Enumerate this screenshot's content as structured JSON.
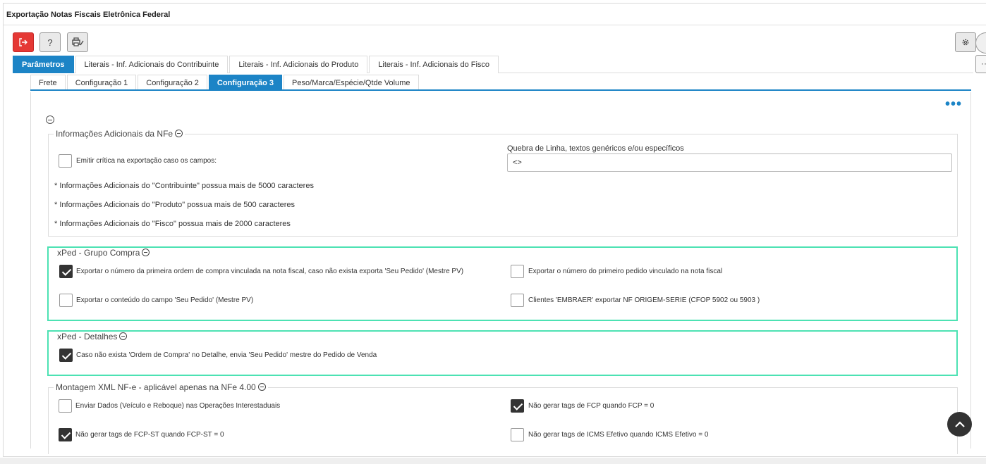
{
  "window": {
    "title": "Exportação Notas Fiscais Eletrônica Federal"
  },
  "toolbar": {
    "exit_icon": "exit-icon",
    "help_label": "?",
    "print_icon": "printer-icon",
    "settings_icon": "gear-icon",
    "side_menu_label": "··"
  },
  "tabs": [
    {
      "label": "Parâmetros",
      "active": true
    },
    {
      "label": "Literais - Inf. Adicionais do Contribuinte",
      "active": false
    },
    {
      "label": "Literais - Inf. Adicionais do Produto",
      "active": false
    },
    {
      "label": "Literais - Inf. Adicionais do Fisco",
      "active": false
    }
  ],
  "subtabs": [
    {
      "label": "Frete",
      "active": false
    },
    {
      "label": "Configuração 1",
      "active": false
    },
    {
      "label": "Configuração 2",
      "active": false
    },
    {
      "label": "Configuração 3",
      "active": true
    },
    {
      "label": "Peso/Marca/Espécie/Qtde Volume",
      "active": false
    }
  ],
  "more_label": "•••",
  "info_group": {
    "legend": "Informações Adicionais da NFe",
    "emitir_label": "Emitir crítica na exportação caso os campos:",
    "emitir_checked": false,
    "quebra_label": "Quebra de Linha, textos genéricos e/ou específicos",
    "quebra_value": "<>",
    "notes": [
      "* Informações Adicionais do \"Contribuinte\" possua mais de 5000 caracteres",
      "* Informações Adicionais do \"Produto\" possua mais de 500 caracteres",
      "* Informações Adicionais do \"Fisco\" possua mais de 2000 caracteres"
    ]
  },
  "xped_compra": {
    "legend": "xPed - Grupo Compra",
    "items": [
      {
        "label": "Exportar o número da primeira ordem de compra vinculada na nota fiscal, caso não exista exporta 'Seu Pedido' (Mestre PV)",
        "checked": true
      },
      {
        "label": "Exportar o número do primeiro pedido vinculado na nota fiscal",
        "checked": false
      },
      {
        "label": "Exportar o conteúdo do campo 'Seu Pedido' (Mestre PV)",
        "checked": false
      },
      {
        "label": "Clientes 'EMBRAER' exportar NF ORIGEM-SERIE (CFOP 5902 ou 5903 )",
        "checked": false
      }
    ]
  },
  "xped_detalhes": {
    "legend": "xPed - Detalhes",
    "items": [
      {
        "label": "Caso não exista 'Ordem de Compra' no Detalhe, envia 'Seu Pedido' mestre do Pedido de Venda",
        "checked": true
      }
    ]
  },
  "montagem": {
    "legend": "Montagem XML NF-e - aplicável apenas na NFe 4.00",
    "items": [
      {
        "label": "Enviar Dados (Veículo e Reboque) nas Operações Interestaduais",
        "checked": false
      },
      {
        "label": "Não gerar tags de FCP quando FCP = 0",
        "checked": true
      },
      {
        "label": "Não gerar tags de FCP-ST quando FCP-ST = 0",
        "checked": true
      },
      {
        "label": "Não gerar tags de ICMS Efetivo quando ICMS Efetivo = 0",
        "checked": false
      }
    ]
  },
  "scroll_top_icon": "chevron-up-icon"
}
